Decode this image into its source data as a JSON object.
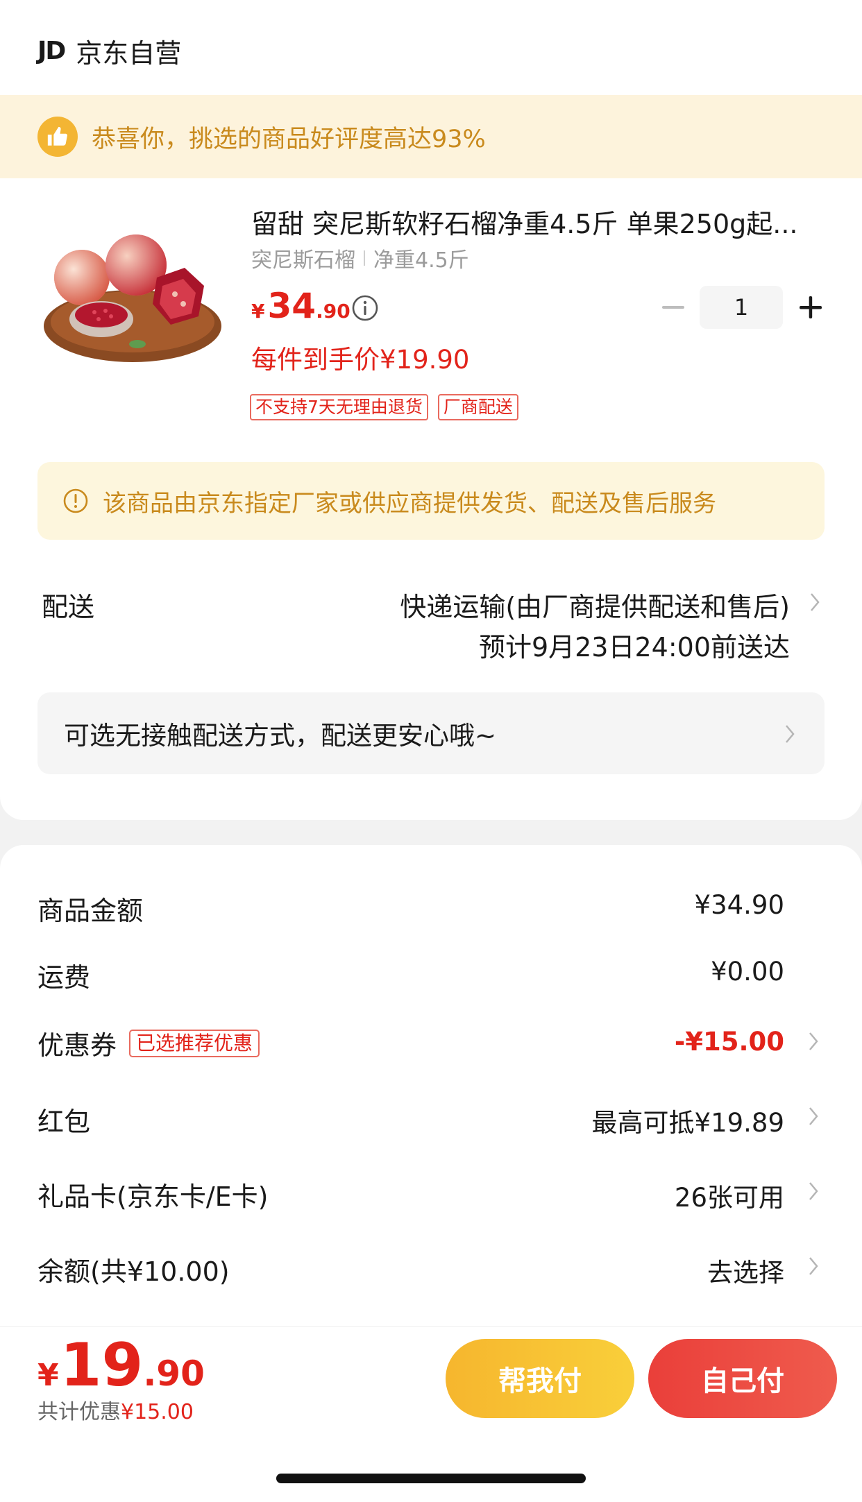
{
  "store": {
    "logo": "JD",
    "name": "京东自营"
  },
  "praise": {
    "text": "恭喜你，挑选的商品好评度高达93%",
    "icon": "thumbs-up-icon"
  },
  "product": {
    "title": "留甜 突尼斯软籽石榴净重4.5斤 单果250g起...",
    "spec_variety": "突尼斯石榴",
    "spec_weight": "净重4.5斤",
    "price_symbol": "¥",
    "price_int": "34",
    "price_dec": ".90",
    "net_price": "每件到手价¥19.90",
    "quantity": "1",
    "tags": [
      "不支持7天无理由退货",
      "厂商配送"
    ]
  },
  "notice": {
    "text": "该商品由京东指定厂家或供应商提供发货、配送及售后服务"
  },
  "delivery": {
    "label": "配送",
    "method": "快递运输(由厂商提供配送和售后)",
    "eta": "预计9月23日24:00前送达"
  },
  "contactless": {
    "text": "可选无接触配送方式，配送更安心哦~"
  },
  "fees": {
    "goods_label": "商品金额",
    "goods_value": "¥34.90",
    "shipping_label": "运费",
    "shipping_value": "¥0.00",
    "coupon_label": "优惠券",
    "coupon_tag": "已选推荐优惠",
    "coupon_value": "-¥15.00",
    "redpacket_label": "红包",
    "redpacket_value": "最高可抵¥19.89",
    "giftcard_label": "礼品卡(京东卡/E卡)",
    "giftcard_value": "26张可用",
    "balance_label": "余额(共¥10.00)",
    "balance_value": "去选择"
  },
  "total": {
    "symbol": "¥",
    "int": "19",
    "dec": ".90",
    "discount_prefix": "共计优惠",
    "discount_amount": "¥15.00"
  },
  "buttons": {
    "help_pay": "帮我付",
    "self_pay": "自己付"
  },
  "colors": {
    "accent_red": "#e2231a",
    "banner_gold": "#c98a1d",
    "banner_bg": "#fdf3dc"
  }
}
